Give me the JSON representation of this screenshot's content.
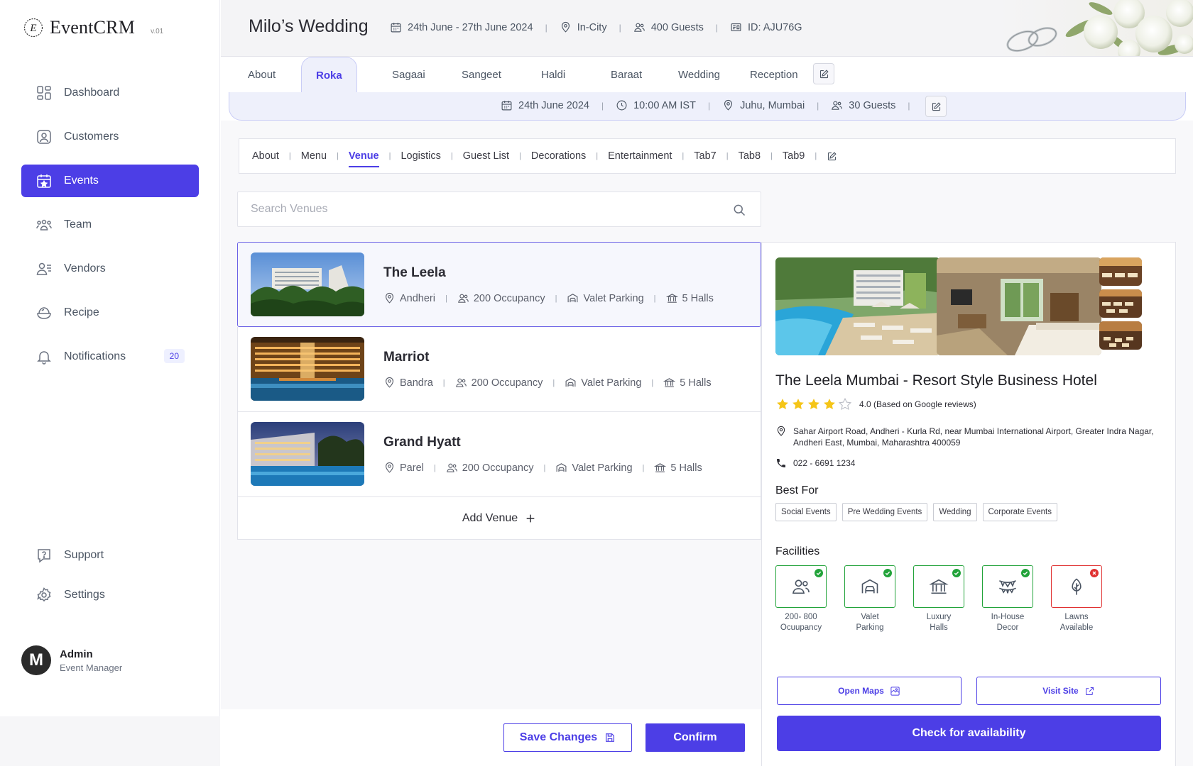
{
  "app": {
    "name": "EventCRM",
    "version": "v.01"
  },
  "colors": {
    "accent": "#4c3ee6",
    "success": "#22a33a",
    "danger": "#e03131",
    "star": "#f5c518"
  },
  "sidebar": {
    "items": [
      {
        "label": "Dashboard",
        "icon": "dashboard-icon"
      },
      {
        "label": "Customers",
        "icon": "customers-icon"
      },
      {
        "label": "Events",
        "icon": "calendar-star-icon",
        "active": true
      },
      {
        "label": "Team",
        "icon": "team-icon"
      },
      {
        "label": "Vendors",
        "icon": "vendors-icon"
      },
      {
        "label": "Recipe",
        "icon": "recipe-icon"
      },
      {
        "label": "Notifications",
        "icon": "bell-icon",
        "badge": "20"
      }
    ],
    "bottom": [
      {
        "label": "Support",
        "icon": "support-icon"
      },
      {
        "label": "Settings",
        "icon": "gear-icon"
      }
    ],
    "profile": {
      "initial": "M",
      "name": "Admin",
      "role": "Event Manager"
    }
  },
  "header": {
    "title": "Milo’s Wedding",
    "dates": "24th June - 27th June 2024",
    "location": "In-City",
    "guests": "400 Guests",
    "id": "ID: AJU76G"
  },
  "subevents": {
    "tabs": [
      "About",
      "Roka",
      "Sagaai",
      "Sangeet",
      "Haldi",
      "Baraat",
      "Wedding",
      "Reception"
    ],
    "active": "Roka",
    "info": {
      "date": "24th June 2024",
      "time": "10:00 AM IST",
      "location": "Juhu, Mumbai",
      "guests": "30 Guests"
    }
  },
  "sections": {
    "tabs": [
      "About",
      "Menu",
      "Venue",
      "Logistics",
      "Guest List",
      "Decorations",
      "Entertainment",
      "Tab7",
      "Tab8",
      "Tab9"
    ],
    "active": "Venue"
  },
  "search": {
    "placeholder": "Search Venues",
    "value": ""
  },
  "venues": [
    {
      "name": "The Leela",
      "area": "Andheri",
      "occupancy": "200 Occupancy",
      "parking": "Valet Parking",
      "halls": "5 Halls",
      "selected": true
    },
    {
      "name": "Marriot",
      "area": "Bandra",
      "occupancy": "200 Occupancy",
      "parking": "Valet Parking",
      "halls": "5 Halls"
    },
    {
      "name": "Grand Hyatt",
      "area": "Parel",
      "occupancy": "200 Occupancy",
      "parking": "Valet Parking",
      "halls": "5 Halls"
    }
  ],
  "add_venue": "Add Venue",
  "detail": {
    "name": "The Leela Mumbai - Resort Style Business Hotel",
    "rating": 4.0,
    "rating_text": "4.0 (Based on Google reviews)",
    "address": "Sahar Airport Road, Andheri - Kurla Rd, near Mumbai International Airport, Greater Indra Nagar, Andheri East, Mumbai, Maharashtra 400059",
    "phone": "022 - 6691 1234",
    "best_for_title": "Best For",
    "best_for": [
      "Social Events",
      "Pre Wedding Events",
      "Wedding",
      "Corporate Events"
    ],
    "facilities_title": "Facilities",
    "facilities": [
      {
        "label_1": "200- 800",
        "label_2": "Ocuupancy",
        "available": true,
        "icon": "people-icon"
      },
      {
        "label_1": "Valet",
        "label_2": "Parking",
        "available": true,
        "icon": "garage-icon"
      },
      {
        "label_1": "Luxury",
        "label_2": "Halls",
        "available": true,
        "icon": "hall-icon"
      },
      {
        "label_1": "In-House",
        "label_2": "Decor",
        "available": true,
        "icon": "bunting-icon"
      },
      {
        "label_1": "Lawns",
        "label_2": "Available",
        "available": false,
        "icon": "tree-icon"
      }
    ],
    "open_maps": "Open Maps",
    "visit_site": "Visit Site",
    "check_availability": "Check for availability"
  },
  "footer": {
    "save": "Save Changes",
    "confirm": "Confirm"
  }
}
